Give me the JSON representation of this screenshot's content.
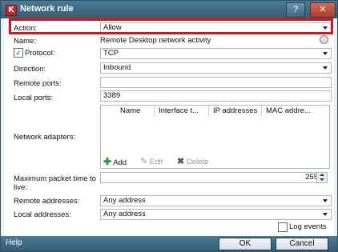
{
  "window": {
    "title": "Network rule",
    "help_btn": "?",
    "close_btn": "✕"
  },
  "form": {
    "action": {
      "label": "Action:",
      "value": "Allow"
    },
    "name": {
      "label": "Name:",
      "value": "Remote Desktop network activity"
    },
    "protocol": {
      "label": "Protocol:",
      "value": "TCP",
      "checked": true
    },
    "direction": {
      "label": "Direction:",
      "value": "Inbound"
    },
    "remote_ports": {
      "label": "Remote ports:",
      "value": ""
    },
    "local_ports": {
      "label": "Local ports:",
      "value": "3389"
    },
    "network_adapters": {
      "label": "Network adapters:",
      "columns": [
        "Name",
        "Interface t...",
        "IP addresses",
        "MAC addre..."
      ],
      "actions": {
        "add": "Add",
        "edit": "Edit",
        "delete": "Delete"
      }
    },
    "max_packet_time": {
      "label_line1": "Maximum packet time to",
      "label_line2": "live:",
      "value": "255"
    },
    "remote_addresses": {
      "label": "Remote addresses:",
      "value": "Any address"
    },
    "local_addresses": {
      "label": "Local addresses:",
      "value": "Any address"
    },
    "log_events": {
      "label": "Log events",
      "checked": false
    }
  },
  "footer": {
    "help": "Help",
    "ok": "OK",
    "cancel": "Cancel"
  }
}
